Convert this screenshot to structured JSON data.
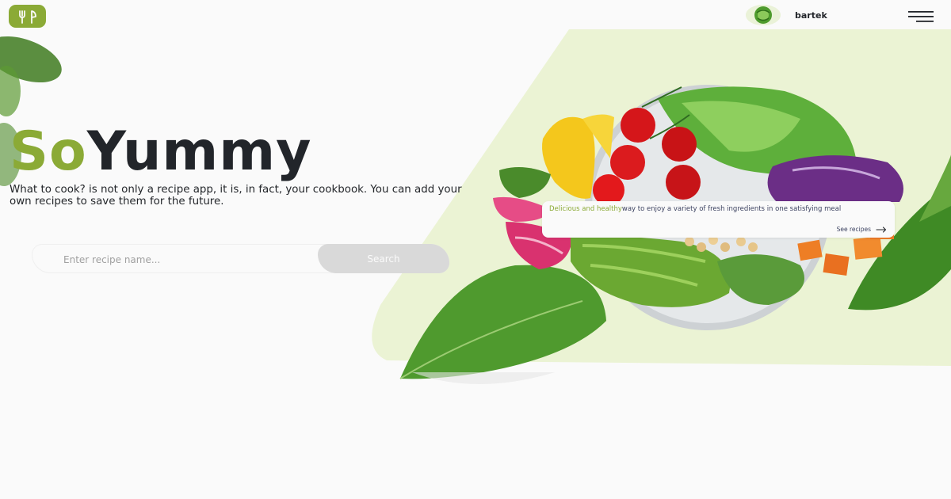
{
  "header": {
    "logo_icon": "utensils-icon",
    "user": {
      "name": "bartek",
      "avatar_icon": "cabbage-avatar"
    },
    "menu_icon": "burger-menu-icon"
  },
  "hero": {
    "title_part1": "So",
    "title_part2": "Yummy",
    "description": "What to cook? is not only a recipe app, it is, in fact, your cookbook. You can add your own recipes to save them for the future."
  },
  "search": {
    "placeholder": "Enter recipe name...",
    "button_label": "Search"
  },
  "card": {
    "accent_text": "Delicious and healthy",
    "text": "way to enjoy a variety of fresh ingredients in one satisfying meal",
    "link_label": "See recipes",
    "link_icon": "arrow-right-icon"
  },
  "colors": {
    "accent": "#8BAA36",
    "dark": "#22252A",
    "panel": "#EBF3D4",
    "background": "#FAFAFA"
  }
}
